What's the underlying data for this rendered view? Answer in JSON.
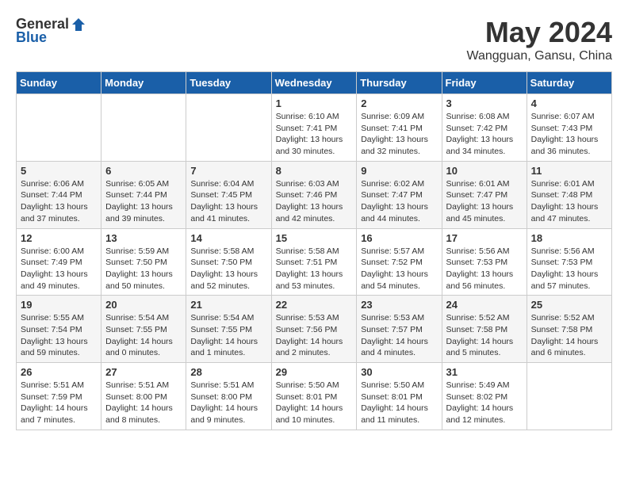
{
  "logo": {
    "general": "General",
    "blue": "Blue"
  },
  "title": {
    "month_year": "May 2024",
    "location": "Wangguan, Gansu, China"
  },
  "weekdays": [
    "Sunday",
    "Monday",
    "Tuesday",
    "Wednesday",
    "Thursday",
    "Friday",
    "Saturday"
  ],
  "weeks": [
    [
      {
        "day": "",
        "info": ""
      },
      {
        "day": "",
        "info": ""
      },
      {
        "day": "",
        "info": ""
      },
      {
        "day": "1",
        "info": "Sunrise: 6:10 AM\nSunset: 7:41 PM\nDaylight: 13 hours\nand 30 minutes."
      },
      {
        "day": "2",
        "info": "Sunrise: 6:09 AM\nSunset: 7:41 PM\nDaylight: 13 hours\nand 32 minutes."
      },
      {
        "day": "3",
        "info": "Sunrise: 6:08 AM\nSunset: 7:42 PM\nDaylight: 13 hours\nand 34 minutes."
      },
      {
        "day": "4",
        "info": "Sunrise: 6:07 AM\nSunset: 7:43 PM\nDaylight: 13 hours\nand 36 minutes."
      }
    ],
    [
      {
        "day": "5",
        "info": "Sunrise: 6:06 AM\nSunset: 7:44 PM\nDaylight: 13 hours\nand 37 minutes."
      },
      {
        "day": "6",
        "info": "Sunrise: 6:05 AM\nSunset: 7:44 PM\nDaylight: 13 hours\nand 39 minutes."
      },
      {
        "day": "7",
        "info": "Sunrise: 6:04 AM\nSunset: 7:45 PM\nDaylight: 13 hours\nand 41 minutes."
      },
      {
        "day": "8",
        "info": "Sunrise: 6:03 AM\nSunset: 7:46 PM\nDaylight: 13 hours\nand 42 minutes."
      },
      {
        "day": "9",
        "info": "Sunrise: 6:02 AM\nSunset: 7:47 PM\nDaylight: 13 hours\nand 44 minutes."
      },
      {
        "day": "10",
        "info": "Sunrise: 6:01 AM\nSunset: 7:47 PM\nDaylight: 13 hours\nand 45 minutes."
      },
      {
        "day": "11",
        "info": "Sunrise: 6:01 AM\nSunset: 7:48 PM\nDaylight: 13 hours\nand 47 minutes."
      }
    ],
    [
      {
        "day": "12",
        "info": "Sunrise: 6:00 AM\nSunset: 7:49 PM\nDaylight: 13 hours\nand 49 minutes."
      },
      {
        "day": "13",
        "info": "Sunrise: 5:59 AM\nSunset: 7:50 PM\nDaylight: 13 hours\nand 50 minutes."
      },
      {
        "day": "14",
        "info": "Sunrise: 5:58 AM\nSunset: 7:50 PM\nDaylight: 13 hours\nand 52 minutes."
      },
      {
        "day": "15",
        "info": "Sunrise: 5:58 AM\nSunset: 7:51 PM\nDaylight: 13 hours\nand 53 minutes."
      },
      {
        "day": "16",
        "info": "Sunrise: 5:57 AM\nSunset: 7:52 PM\nDaylight: 13 hours\nand 54 minutes."
      },
      {
        "day": "17",
        "info": "Sunrise: 5:56 AM\nSunset: 7:53 PM\nDaylight: 13 hours\nand 56 minutes."
      },
      {
        "day": "18",
        "info": "Sunrise: 5:56 AM\nSunset: 7:53 PM\nDaylight: 13 hours\nand 57 minutes."
      }
    ],
    [
      {
        "day": "19",
        "info": "Sunrise: 5:55 AM\nSunset: 7:54 PM\nDaylight: 13 hours\nand 59 minutes."
      },
      {
        "day": "20",
        "info": "Sunrise: 5:54 AM\nSunset: 7:55 PM\nDaylight: 14 hours\nand 0 minutes."
      },
      {
        "day": "21",
        "info": "Sunrise: 5:54 AM\nSunset: 7:55 PM\nDaylight: 14 hours\nand 1 minutes."
      },
      {
        "day": "22",
        "info": "Sunrise: 5:53 AM\nSunset: 7:56 PM\nDaylight: 14 hours\nand 2 minutes."
      },
      {
        "day": "23",
        "info": "Sunrise: 5:53 AM\nSunset: 7:57 PM\nDaylight: 14 hours\nand 4 minutes."
      },
      {
        "day": "24",
        "info": "Sunrise: 5:52 AM\nSunset: 7:58 PM\nDaylight: 14 hours\nand 5 minutes."
      },
      {
        "day": "25",
        "info": "Sunrise: 5:52 AM\nSunset: 7:58 PM\nDaylight: 14 hours\nand 6 minutes."
      }
    ],
    [
      {
        "day": "26",
        "info": "Sunrise: 5:51 AM\nSunset: 7:59 PM\nDaylight: 14 hours\nand 7 minutes."
      },
      {
        "day": "27",
        "info": "Sunrise: 5:51 AM\nSunset: 8:00 PM\nDaylight: 14 hours\nand 8 minutes."
      },
      {
        "day": "28",
        "info": "Sunrise: 5:51 AM\nSunset: 8:00 PM\nDaylight: 14 hours\nand 9 minutes."
      },
      {
        "day": "29",
        "info": "Sunrise: 5:50 AM\nSunset: 8:01 PM\nDaylight: 14 hours\nand 10 minutes."
      },
      {
        "day": "30",
        "info": "Sunrise: 5:50 AM\nSunset: 8:01 PM\nDaylight: 14 hours\nand 11 minutes."
      },
      {
        "day": "31",
        "info": "Sunrise: 5:49 AM\nSunset: 8:02 PM\nDaylight: 14 hours\nand 12 minutes."
      },
      {
        "day": "",
        "info": ""
      }
    ]
  ]
}
